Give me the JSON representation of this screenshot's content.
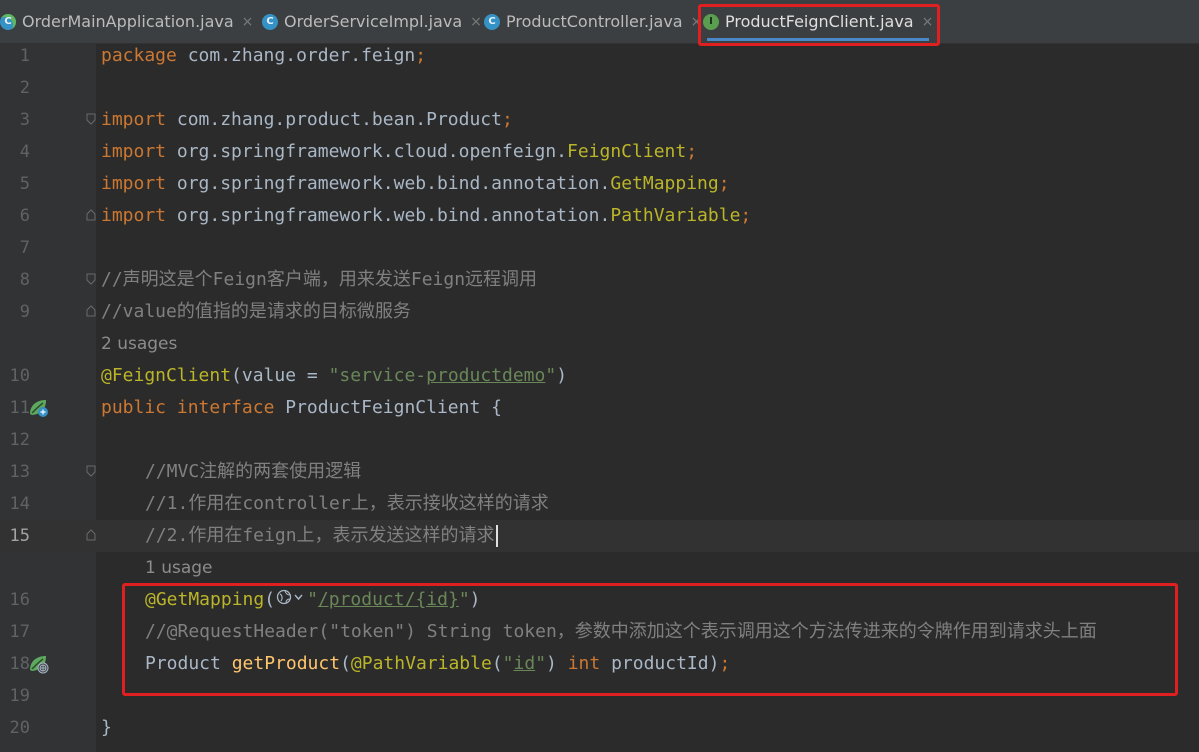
{
  "tabs": [
    {
      "label": "OrderMainApplication.java",
      "icon": "spring-app-class-icon",
      "active": false
    },
    {
      "label": "OrderServiceImpl.java",
      "icon": "class-icon",
      "active": false
    },
    {
      "label": "ProductController.java",
      "icon": "class-icon",
      "active": false
    },
    {
      "label": "ProductFeignClient.java",
      "icon": "interface-icon",
      "active": true
    }
  ],
  "tab_icon_letters": {
    "class": "C",
    "interface": "I"
  },
  "close_glyph": "×",
  "line_numbers": [
    "1",
    "2",
    "3",
    "4",
    "5",
    "6",
    "7",
    "8",
    "9",
    "10",
    "11",
    "12",
    "13",
    "14",
    "15",
    "16",
    "17",
    "18",
    "19",
    "20"
  ],
  "code": {
    "l1_kw": "package",
    "l1_rest": " com.zhang.order.feign",
    "l3_kw": "import",
    "l3_rest": " com.zhang.product.bean.Product",
    "l4_kw": "import",
    "l4_pkg": " org.springframework.cloud.openfeign.",
    "l4_cls": "FeignClient",
    "l5_kw": "import",
    "l5_pkg": " org.springframework.web.bind.annotation.",
    "l5_cls": "GetMapping",
    "l6_kw": "import",
    "l6_pkg": " org.springframework.web.bind.annotation.",
    "l6_cls": "PathVariable",
    "semi": ";",
    "l8_cmt": "//声明这是个Feign客户端，用来发送Feign远程调用",
    "l9_cmt": "//value的值指的是请求的目标微服务",
    "usages_2": "2 usages",
    "l10_ann": "@FeignClient",
    "l10_open": "(value = ",
    "l10_str_a": "\"service-",
    "l10_str_b": "productdemo",
    "l10_str_c": "\"",
    "l10_close": ")",
    "l11_kw1": "public",
    "l11_kw2": " interface",
    "l11_rest": " ProductFeignClient {",
    "l13_cmt": "//MVC注解的两套使用逻辑",
    "l14_cmt": "//1.作用在controller上，表示接收这样的请求",
    "l15_cmt": "//2.作用在feign上，表示发送这样的请求",
    "usages_1": "1 usage",
    "l16_ann": "@GetMapping",
    "l16_open": "(",
    "l16_str_a": "\"",
    "l16_str_b": "/product/",
    "l16_str_c": "{id}",
    "l16_str_d": "\"",
    "l16_close": ")",
    "l17_cmt": "//@RequestHeader(\"token\") String token，参数中添加这个表示调用这个方法传进来的令牌作用到请求头上面",
    "l18_type": "Product ",
    "l18_fn": "getProduct",
    "l18_open": "(",
    "l18_ann": "@PathVariable",
    "l18_p1": "(",
    "l18_str_a": "\"",
    "l18_str_b": "id",
    "l18_str_c": "\"",
    "l18_p2": ") ",
    "l18_kw": "int",
    "l18_rest": " productId)",
    "l20_brace": "}"
  },
  "colors": {
    "keyword": "#cc7832",
    "annotation": "#bbb529",
    "string": "#6a8759",
    "comment": "#808080",
    "method": "#ffc66d",
    "highlight_box": "#e02020"
  }
}
